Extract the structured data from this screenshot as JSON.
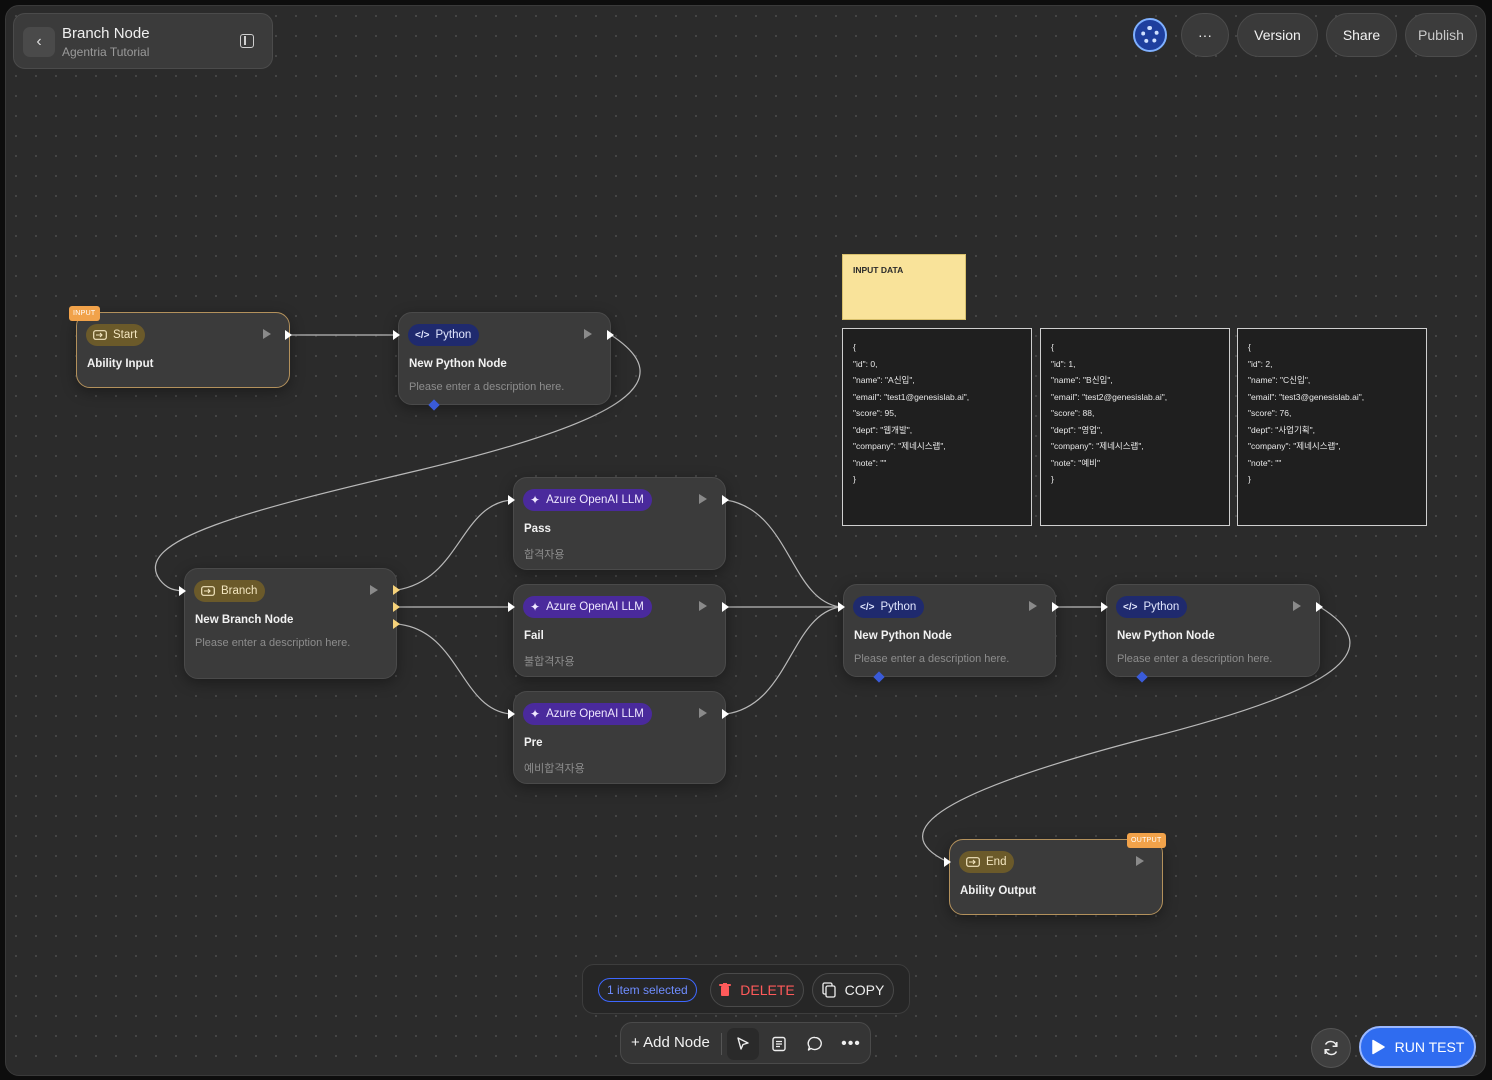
{
  "header": {
    "title": "Branch Node",
    "subtitle": "Agentria Tutorial",
    "version_label": "Version",
    "share_label": "Share",
    "publish_label": "Publish",
    "more_label": "···"
  },
  "nodes": {
    "start": {
      "badge": "INPUT",
      "tag": "Start",
      "title": "Ability Input"
    },
    "python1": {
      "tag": "Python",
      "title": "New Python Node",
      "desc": "Please enter a description here."
    },
    "branch": {
      "tag": "Branch",
      "title": "New Branch Node",
      "desc": "Please enter a description here."
    },
    "llm_pass": {
      "tag": "Azure OpenAI LLM",
      "title": "Pass",
      "desc": "합격자용"
    },
    "llm_fail": {
      "tag": "Azure OpenAI LLM",
      "title": "Fail",
      "desc": "불합격자용"
    },
    "llm_pre": {
      "tag": "Azure OpenAI LLM",
      "title": "Pre",
      "desc": "예비합격자용"
    },
    "python2": {
      "tag": "Python",
      "title": "New Python Node",
      "desc": "Please enter a description here."
    },
    "python3": {
      "tag": "Python",
      "title": "New Python Node",
      "desc": "Please enter a description here."
    },
    "end": {
      "badge": "OUTPUT",
      "tag": "End",
      "title": "Ability Output"
    }
  },
  "notes": {
    "input_data": "INPUT DATA",
    "records": [
      [
        "{",
        "\"id\": 0,",
        "\"name\": \"A신입\",",
        "\"email\": \"test1@genesislab.ai\",",
        "\"score\": 95,",
        "\"dept\": \"웹개발\",",
        "\"company\": \"제네시스랩\",",
        "\"note\": \"\"",
        "}"
      ],
      [
        "{",
        "\"id\": 1,",
        "\"name\": \"B신입\",",
        "\"email\": \"test2@genesislab.ai\",",
        "\"score\": 88,",
        "\"dept\": \"영업\",",
        "\"company\": \"제네시스랩\",",
        "\"note\": \"예비\"",
        "}"
      ],
      [
        "{",
        "\"id\": 2,",
        "\"name\": \"C신입\",",
        "\"email\": \"test3@genesislab.ai\",",
        "\"score\": 76,",
        "\"dept\": \"사업기획\",",
        "\"company\": \"제네시스랩\",",
        "\"note\": \"\"",
        "}"
      ]
    ]
  },
  "selection": {
    "count_label": "1 item selected",
    "delete_label": "DELETE",
    "copy_label": "COPY"
  },
  "bottom_bar": {
    "add_node_label": "+ Add Node"
  },
  "run_test_label": "RUN TEST",
  "colors": {
    "accent_blue": "#2f6cf0",
    "delete_red": "#ff5a5a",
    "io_border": "#b3915c",
    "badge_orange": "#f1a24a"
  }
}
